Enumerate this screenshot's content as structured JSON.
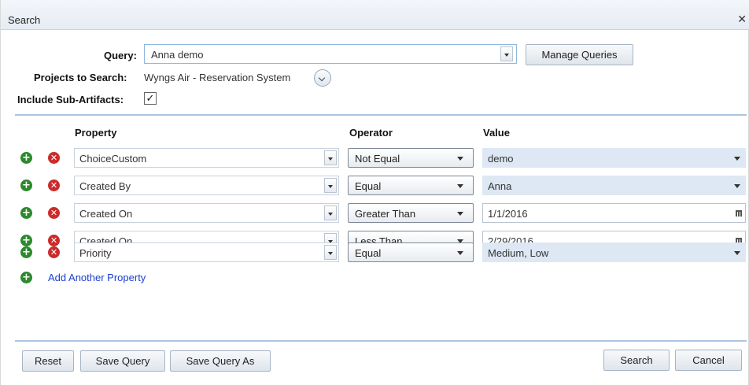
{
  "dialog": {
    "title": "Search"
  },
  "query": {
    "label": "Query:",
    "value": "Anna demo",
    "manage_label": "Manage Queries"
  },
  "projects": {
    "label": "Projects to Search:",
    "value": "Wyngs Air - Reservation System"
  },
  "subartifacts": {
    "label": "Include Sub-Artifacts:",
    "checked": true,
    "mark": "✓"
  },
  "columns": {
    "property": "Property",
    "operator": "Operator",
    "value": "Value"
  },
  "rows": [
    {
      "property": "ChoiceCustom",
      "operator": "Not Equal",
      "value": "demo",
      "value_type": "select"
    },
    {
      "property": "Created By",
      "operator": "Equal",
      "value": "Anna",
      "value_type": "select"
    },
    {
      "property": "Created On",
      "operator": "Greater Than",
      "value": "1/1/2016",
      "value_type": "date"
    },
    {
      "property": "Created On",
      "operator": "Less Than",
      "value": "2/29/2016",
      "value_type": "date"
    },
    {
      "property": "Priority",
      "operator": "Equal",
      "value": "Medium, Low",
      "value_type": "select"
    }
  ],
  "add_property_label": "Add Another Property",
  "footer": {
    "reset": "Reset",
    "save_query": "Save Query",
    "save_query_as": "Save Query As",
    "search": "Search",
    "cancel": "Cancel"
  },
  "icons": {
    "close": "close-icon",
    "add": "plus-circle-icon",
    "remove": "x-circle-icon",
    "calendar": "calendar-icon"
  },
  "colors": {
    "add": "#2c8a2c",
    "remove": "#cc2b2b",
    "link": "#1a3fd0",
    "accent": "#aac6e3"
  }
}
